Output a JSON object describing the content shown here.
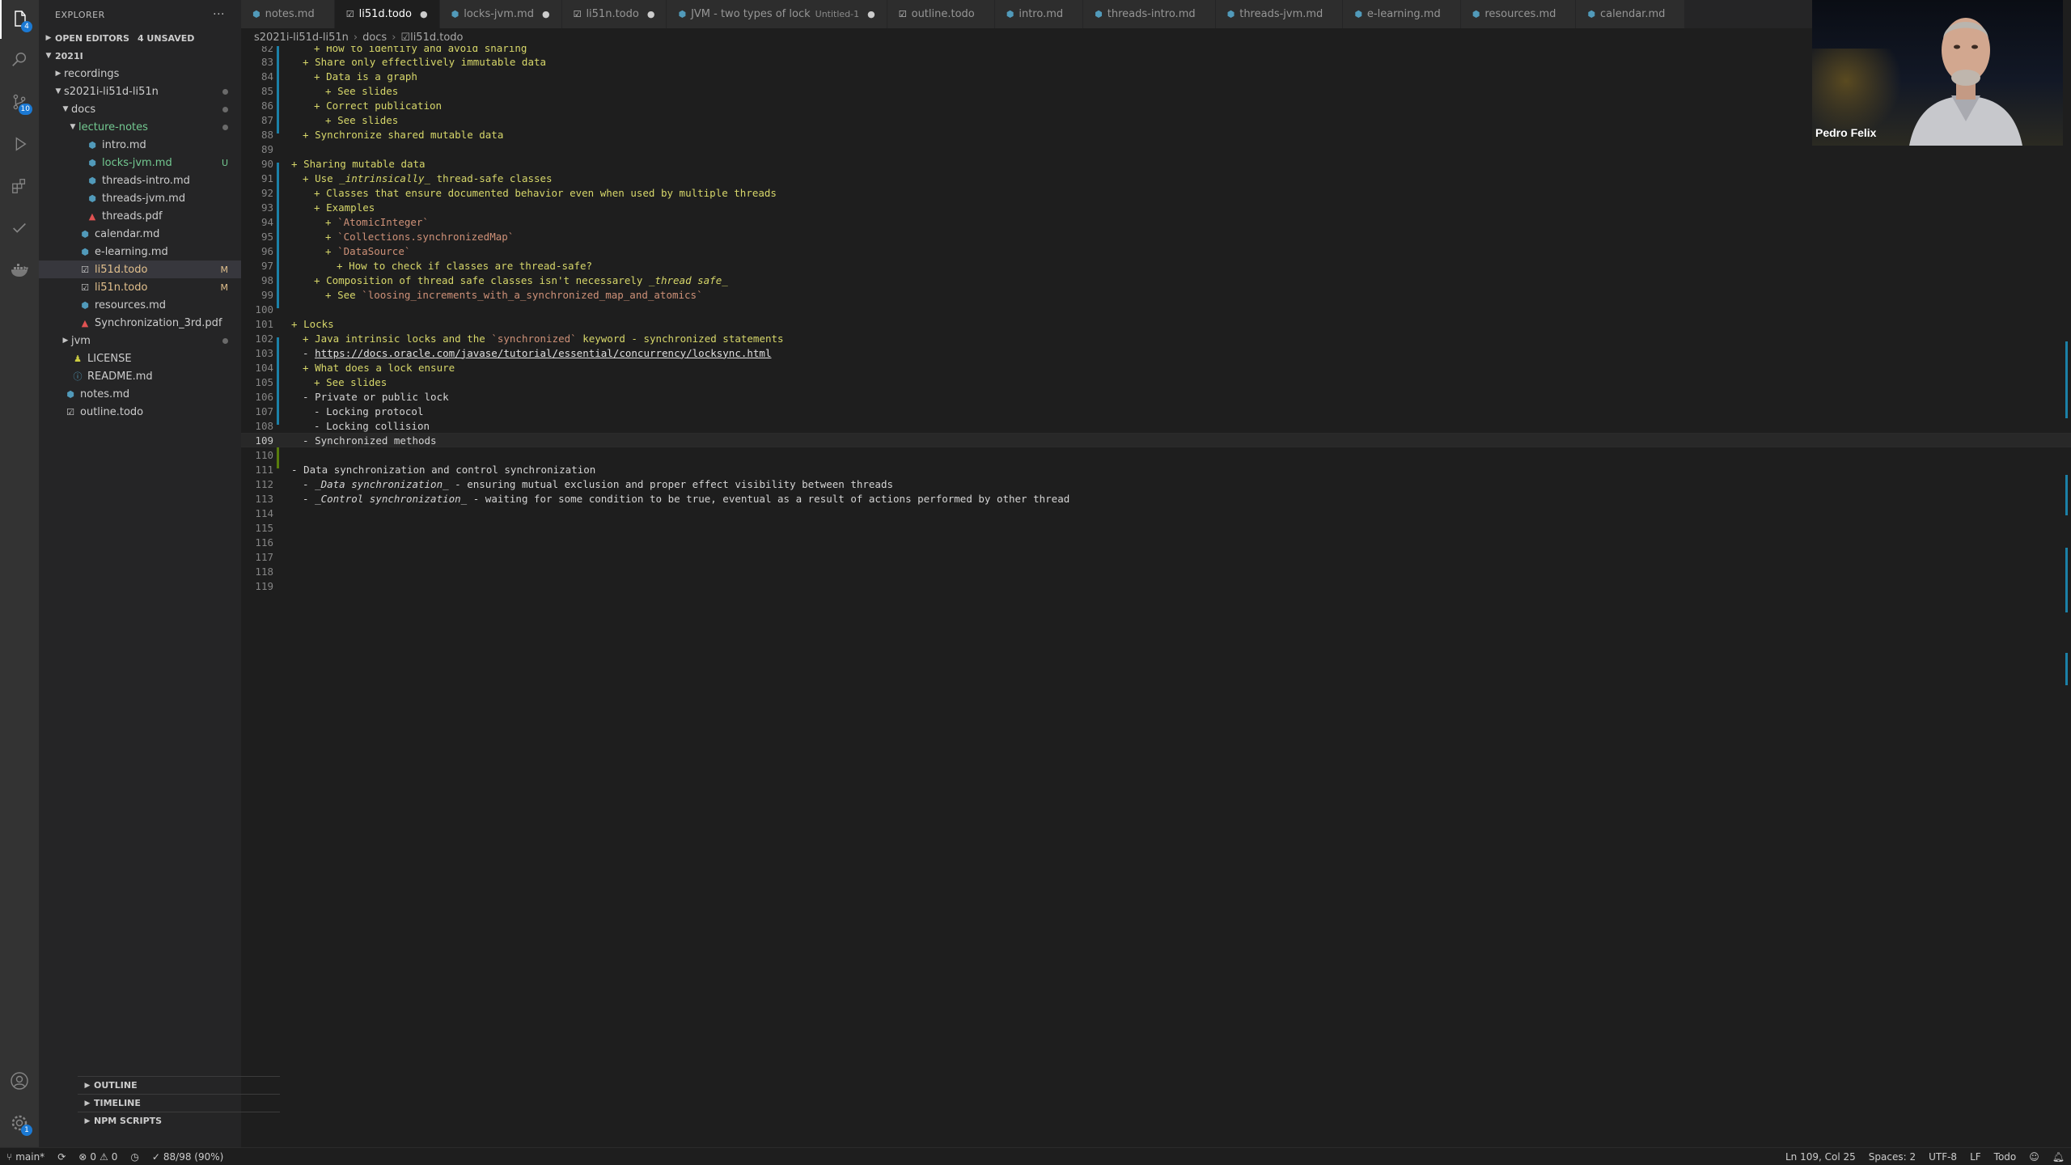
{
  "activity": {
    "scm_badge": "10",
    "explorer_badge": "4",
    "settings_badge": "1"
  },
  "sidebar": {
    "title": "EXPLORER",
    "open_editors": {
      "label": "OPEN EDITORS",
      "unsaved": "4 UNSAVED"
    },
    "workspace": "2021I",
    "tree": [
      {
        "label": "recordings",
        "type": "folder",
        "depth": 1,
        "open": false,
        "deco": ""
      },
      {
        "label": "s2021i-li51d-li51n",
        "type": "folder",
        "depth": 1,
        "open": true,
        "deco": "dot"
      },
      {
        "label": "docs",
        "type": "folder",
        "depth": 2,
        "open": true,
        "deco": "dot"
      },
      {
        "label": "lecture-notes",
        "type": "folder",
        "depth": 3,
        "open": true,
        "deco": "dot"
      },
      {
        "label": "intro.md",
        "type": "md",
        "depth": 4,
        "deco": ""
      },
      {
        "label": "locks-jvm.md",
        "type": "md",
        "depth": 4,
        "deco": "U"
      },
      {
        "label": "threads-intro.md",
        "type": "md",
        "depth": 4,
        "deco": ""
      },
      {
        "label": "threads-jvm.md",
        "type": "md",
        "depth": 4,
        "deco": ""
      },
      {
        "label": "threads.pdf",
        "type": "pdf",
        "depth": 4,
        "deco": ""
      },
      {
        "label": "calendar.md",
        "type": "md",
        "depth": 3,
        "deco": ""
      },
      {
        "label": "e-learning.md",
        "type": "md",
        "depth": 3,
        "deco": ""
      },
      {
        "label": "li51d.todo",
        "type": "todo",
        "depth": 3,
        "deco": "M",
        "selected": true
      },
      {
        "label": "li51n.todo",
        "type": "todo",
        "depth": 3,
        "deco": "M"
      },
      {
        "label": "resources.md",
        "type": "md",
        "depth": 3,
        "deco": ""
      },
      {
        "label": "Synchronization_3rd.pdf",
        "type": "pdf",
        "depth": 3,
        "deco": ""
      },
      {
        "label": "jvm",
        "type": "folder",
        "depth": 2,
        "open": false,
        "deco": "dot"
      },
      {
        "label": "LICENSE",
        "type": "license",
        "depth": 2,
        "deco": ""
      },
      {
        "label": "README.md",
        "type": "info",
        "depth": 2,
        "deco": ""
      },
      {
        "label": "notes.md",
        "type": "md",
        "depth": 1,
        "deco": ""
      },
      {
        "label": "outline.todo",
        "type": "todo",
        "depth": 1,
        "deco": ""
      }
    ],
    "panels": [
      "OUTLINE",
      "TIMELINE",
      "NPM SCRIPTS"
    ]
  },
  "tabs": [
    {
      "label": "notes.md",
      "icon": "md",
      "active": false,
      "dirty": false,
      "desc": ""
    },
    {
      "label": "li51d.todo",
      "icon": "todo",
      "active": true,
      "dirty": true,
      "desc": ""
    },
    {
      "label": "locks-jvm.md",
      "icon": "md",
      "active": false,
      "dirty": true,
      "desc": ""
    },
    {
      "label": "li51n.todo",
      "icon": "todo",
      "active": false,
      "dirty": true,
      "desc": ""
    },
    {
      "label": "JVM - two types of lock",
      "icon": "md",
      "active": false,
      "dirty": true,
      "desc": "Untitled-1"
    },
    {
      "label": "outline.todo",
      "icon": "todo",
      "active": false,
      "dirty": false,
      "desc": ""
    },
    {
      "label": "intro.md",
      "icon": "md",
      "active": false,
      "dirty": false,
      "desc": ""
    },
    {
      "label": "threads-intro.md",
      "icon": "md",
      "active": false,
      "dirty": false,
      "desc": ""
    },
    {
      "label": "threads-jvm.md",
      "icon": "md",
      "active": false,
      "dirty": false,
      "desc": ""
    },
    {
      "label": "e-learning.md",
      "icon": "md",
      "active": false,
      "dirty": false,
      "desc": ""
    },
    {
      "label": "resources.md",
      "icon": "md",
      "active": false,
      "dirty": false,
      "desc": ""
    },
    {
      "label": "calendar.md",
      "icon": "md",
      "active": false,
      "dirty": false,
      "desc": ""
    }
  ],
  "breadcrumbs": [
    "s2021i-li51d-li51n",
    "docs",
    "li51d.todo"
  ],
  "editor": {
    "current_line": 109,
    "lines": [
      {
        "n": 82,
        "indent": 2,
        "bullet": "+",
        "segs": [
          {
            "t": "How to identify and avoid sharing",
            "c": "y"
          }
        ],
        "partial": true
      },
      {
        "n": 83,
        "indent": 1,
        "bullet": "+",
        "segs": [
          {
            "t": "Share only effectlively immutable data",
            "c": "y"
          }
        ]
      },
      {
        "n": 84,
        "indent": 2,
        "bullet": "+",
        "segs": [
          {
            "t": "Data is a graph",
            "c": "y"
          }
        ]
      },
      {
        "n": 85,
        "indent": 3,
        "bullet": "+",
        "segs": [
          {
            "t": "See slides",
            "c": "y"
          }
        ]
      },
      {
        "n": 86,
        "indent": 2,
        "bullet": "+",
        "segs": [
          {
            "t": "Correct publication",
            "c": "y"
          }
        ]
      },
      {
        "n": 87,
        "indent": 3,
        "bullet": "+",
        "segs": [
          {
            "t": "See slides",
            "c": "y"
          }
        ]
      },
      {
        "n": 88,
        "indent": 1,
        "bullet": "+",
        "segs": [
          {
            "t": "Synchronize shared mutable data",
            "c": "y"
          }
        ]
      },
      {
        "n": 89,
        "indent": 0,
        "bullet": "",
        "segs": []
      },
      {
        "n": 90,
        "indent": 0,
        "bullet": "+",
        "segs": [
          {
            "t": "Sharing mutable data",
            "c": "y"
          }
        ]
      },
      {
        "n": 91,
        "indent": 1,
        "bullet": "+",
        "segs": [
          {
            "t": "Use ",
            "c": "y"
          },
          {
            "t": "_intrinsically_",
            "c": "yi"
          },
          {
            "t": " thread-safe classes",
            "c": "y"
          }
        ]
      },
      {
        "n": 92,
        "indent": 2,
        "bullet": "+",
        "segs": [
          {
            "t": "Classes that ensure documented behavior even when used by multiple threads",
            "c": "y"
          }
        ]
      },
      {
        "n": 93,
        "indent": 2,
        "bullet": "+",
        "segs": [
          {
            "t": "Examples",
            "c": "y"
          }
        ]
      },
      {
        "n": 94,
        "indent": 3,
        "bullet": "+",
        "segs": [
          {
            "t": "`AtomicInteger`",
            "c": "o"
          }
        ]
      },
      {
        "n": 95,
        "indent": 3,
        "bullet": "+",
        "segs": [
          {
            "t": "`Collections.synchronizedMap`",
            "c": "o"
          }
        ]
      },
      {
        "n": 96,
        "indent": 3,
        "bullet": "+",
        "segs": [
          {
            "t": "`DataSource`",
            "c": "o"
          }
        ]
      },
      {
        "n": 97,
        "indent": 4,
        "bullet": "+",
        "segs": [
          {
            "t": "How to check if classes are thread-safe?",
            "c": "y"
          }
        ]
      },
      {
        "n": 98,
        "indent": 2,
        "bullet": "+",
        "segs": [
          {
            "t": "Composition of thread safe classes isn't necessarely ",
            "c": "y"
          },
          {
            "t": "_thread safe_",
            "c": "yi"
          }
        ]
      },
      {
        "n": 99,
        "indent": 3,
        "bullet": "+",
        "segs": [
          {
            "t": "See ",
            "c": "y"
          },
          {
            "t": "`loosing_increments_with_a_synchronized_map_and_atomics`",
            "c": "o"
          }
        ]
      },
      {
        "n": 100,
        "indent": 0,
        "bullet": "",
        "segs": []
      },
      {
        "n": 101,
        "indent": 0,
        "bullet": "+",
        "segs": [
          {
            "t": "Locks",
            "c": "y"
          }
        ]
      },
      {
        "n": 102,
        "indent": 1,
        "bullet": "+",
        "segs": [
          {
            "t": "Java intrinsic locks and the ",
            "c": "y"
          },
          {
            "t": "`synchronized`",
            "c": "o"
          },
          {
            "t": " keyword - synchronized statements",
            "c": "y"
          }
        ]
      },
      {
        "n": 103,
        "indent": 1,
        "bullet": "-",
        "segs": [
          {
            "t": "https://docs.oracle.com/javase/tutorial/essential/concurrency/locksync.html",
            "c": "link"
          }
        ]
      },
      {
        "n": 104,
        "indent": 1,
        "bullet": "+",
        "segs": [
          {
            "t": "What does a lock ensure",
            "c": "y"
          }
        ]
      },
      {
        "n": 105,
        "indent": 2,
        "bullet": "+",
        "segs": [
          {
            "t": "See slides",
            "c": "y"
          }
        ]
      },
      {
        "n": 106,
        "indent": 1,
        "bullet": "-",
        "segs": [
          {
            "t": "Private or public lock",
            "c": "w"
          }
        ]
      },
      {
        "n": 107,
        "indent": 2,
        "bullet": "-",
        "segs": [
          {
            "t": "Locking protocol",
            "c": "w"
          }
        ]
      },
      {
        "n": 108,
        "indent": 2,
        "bullet": "-",
        "segs": [
          {
            "t": "Locking collision",
            "c": "w"
          }
        ]
      },
      {
        "n": 109,
        "indent": 1,
        "bullet": "-",
        "segs": [
          {
            "t": "Synchronized methods",
            "c": "w"
          }
        ]
      },
      {
        "n": 110,
        "indent": 0,
        "bullet": "",
        "segs": []
      },
      {
        "n": 111,
        "indent": 0,
        "bullet": "-",
        "segs": [
          {
            "t": "Data synchronization and control synchronization",
            "c": "w"
          }
        ]
      },
      {
        "n": 112,
        "indent": 1,
        "bullet": "-",
        "segs": [
          {
            "t": "_Data synchronization_",
            "c": "wi"
          },
          {
            "t": " - ensuring mutual exclusion and proper effect visibility between threads",
            "c": "w"
          }
        ]
      },
      {
        "n": 113,
        "indent": 1,
        "bullet": "-",
        "segs": [
          {
            "t": "_Control synchronization_",
            "c": "wi"
          },
          {
            "t": " - waiting for some condition to be true, eventual as a result of actions performed by other thread",
            "c": "w"
          }
        ]
      },
      {
        "n": 114,
        "indent": 0,
        "bullet": "",
        "segs": []
      },
      {
        "n": 115,
        "indent": 0,
        "bullet": "",
        "segs": []
      },
      {
        "n": 116,
        "indent": 0,
        "bullet": "",
        "segs": []
      },
      {
        "n": 117,
        "indent": 0,
        "bullet": "",
        "segs": []
      },
      {
        "n": 118,
        "indent": 0,
        "bullet": "",
        "segs": []
      },
      {
        "n": 119,
        "indent": 0,
        "bullet": "",
        "segs": []
      }
    ]
  },
  "status": {
    "branch": "main*",
    "errors": "0",
    "warnings": "0",
    "todo_progress": "88/98 (90%)",
    "position": "Ln 109, Col 25",
    "spaces": "Spaces: 2",
    "encoding": "UTF-8",
    "eol": "LF",
    "language": "Todo"
  },
  "video": {
    "name": "Pedro Felix"
  },
  "colors": {
    "yellow_text": "#d7d76a",
    "orange_code": "#ce9178",
    "link": "#e0e0e0",
    "accent": "#1b81a8"
  }
}
